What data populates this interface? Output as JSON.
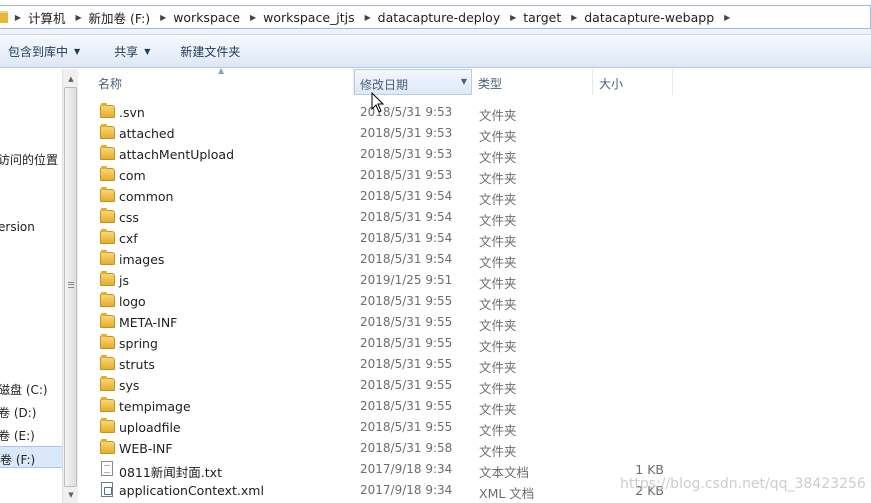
{
  "address_bar": {
    "segments": [
      "计算机",
      "新加卷 (F:)",
      "workspace",
      "workspace_jtjs",
      "datacapture-deploy",
      "target",
      "datacapture-webapp"
    ]
  },
  "toolbar": {
    "include_library": "包含到库中",
    "share": "共享",
    "new_folder": "新建文件夹"
  },
  "nav": {
    "items": [
      {
        "label": "访问的位置"
      },
      {
        "label": "ersion"
      },
      {
        "label": "磁盘 (C:)"
      },
      {
        "label": "卷 (D:)"
      },
      {
        "label": "卷 (E:)"
      },
      {
        "label": "卷 (F:)"
      }
    ]
  },
  "columns": {
    "name": "名称",
    "date": "修改日期",
    "type": "类型",
    "size": "大小"
  },
  "files": [
    {
      "name": ".svn",
      "date": "2018/5/31 9:53",
      "type": "文件夹",
      "size": "",
      "icon": "folder-icon"
    },
    {
      "name": "attached",
      "date": "2018/5/31 9:53",
      "type": "文件夹",
      "size": "",
      "icon": "folder-icon"
    },
    {
      "name": "attachMentUpload",
      "date": "2018/5/31 9:53",
      "type": "文件夹",
      "size": "",
      "icon": "folder-icon"
    },
    {
      "name": "com",
      "date": "2018/5/31 9:53",
      "type": "文件夹",
      "size": "",
      "icon": "folder-icon"
    },
    {
      "name": "common",
      "date": "2018/5/31 9:54",
      "type": "文件夹",
      "size": "",
      "icon": "folder-icon"
    },
    {
      "name": "css",
      "date": "2018/5/31 9:54",
      "type": "文件夹",
      "size": "",
      "icon": "folder-icon"
    },
    {
      "name": "cxf",
      "date": "2018/5/31 9:54",
      "type": "文件夹",
      "size": "",
      "icon": "folder-icon"
    },
    {
      "name": "images",
      "date": "2018/5/31 9:54",
      "type": "文件夹",
      "size": "",
      "icon": "folder-icon"
    },
    {
      "name": "js",
      "date": "2019/1/25 9:51",
      "type": "文件夹",
      "size": "",
      "icon": "folder-icon"
    },
    {
      "name": "logo",
      "date": "2018/5/31 9:55",
      "type": "文件夹",
      "size": "",
      "icon": "folder-icon"
    },
    {
      "name": "META-INF",
      "date": "2018/5/31 9:55",
      "type": "文件夹",
      "size": "",
      "icon": "folder-icon"
    },
    {
      "name": "spring",
      "date": "2018/5/31 9:55",
      "type": "文件夹",
      "size": "",
      "icon": "folder-icon"
    },
    {
      "name": "struts",
      "date": "2018/5/31 9:55",
      "type": "文件夹",
      "size": "",
      "icon": "folder-icon"
    },
    {
      "name": "sys",
      "date": "2018/5/31 9:55",
      "type": "文件夹",
      "size": "",
      "icon": "folder-icon"
    },
    {
      "name": "tempimage",
      "date": "2018/5/31 9:55",
      "type": "文件夹",
      "size": "",
      "icon": "folder-icon"
    },
    {
      "name": "uploadfile",
      "date": "2018/5/31 9:55",
      "type": "文件夹",
      "size": "",
      "icon": "folder-icon"
    },
    {
      "name": "WEB-INF",
      "date": "2018/5/31 9:58",
      "type": "文件夹",
      "size": "",
      "icon": "folder-icon"
    },
    {
      "name": "0811新闻封面.txt",
      "date": "2017/9/18 9:34",
      "type": "文本文档",
      "size": "1 KB",
      "icon": "text-file-icon"
    },
    {
      "name": "applicationContext.xml",
      "date": "2017/9/18 9:34",
      "type": "XML 文档",
      "size": "2 KB",
      "icon": "xml-file-icon"
    }
  ],
  "watermark": "https://blog.csdn.net/qq_38423256"
}
